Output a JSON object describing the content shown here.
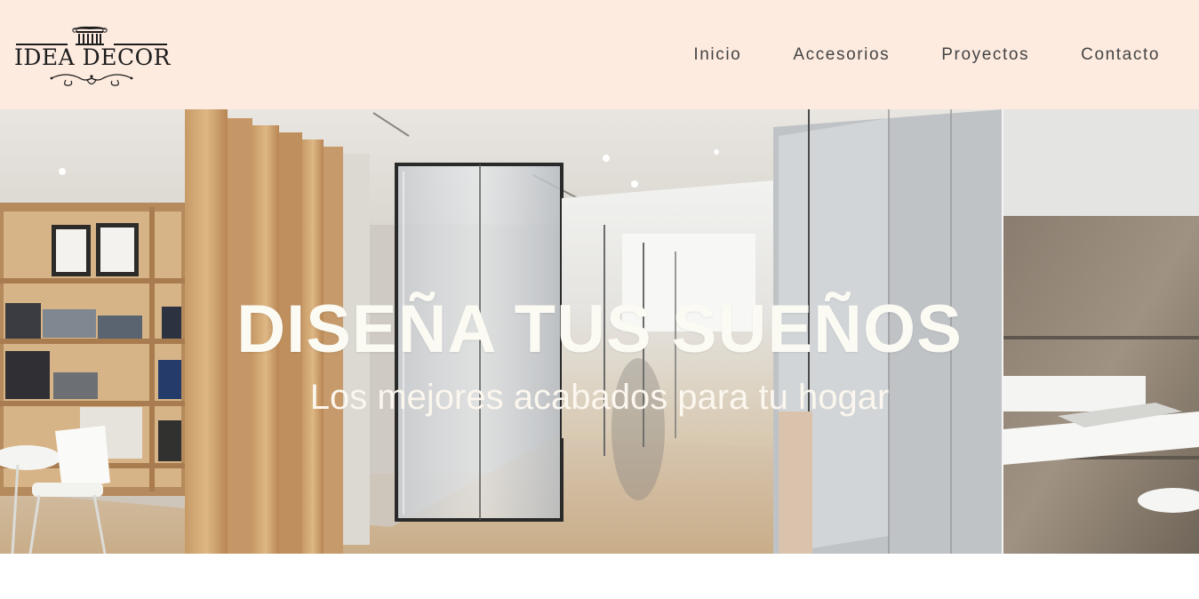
{
  "brand": {
    "name": "IDEA DECOR"
  },
  "nav": {
    "items": [
      {
        "label": "Inicio"
      },
      {
        "label": "Accesorios"
      },
      {
        "label": "Proyectos"
      },
      {
        "label": "Contacto"
      }
    ]
  },
  "hero": {
    "title": "DISEÑA TUS SUEÑOS",
    "subtitle": "Los mejores acabados para tu hogar"
  },
  "colors": {
    "header_bg": "#fdebe0",
    "nav_text": "#444444",
    "hero_text": "#fbfbf4"
  }
}
